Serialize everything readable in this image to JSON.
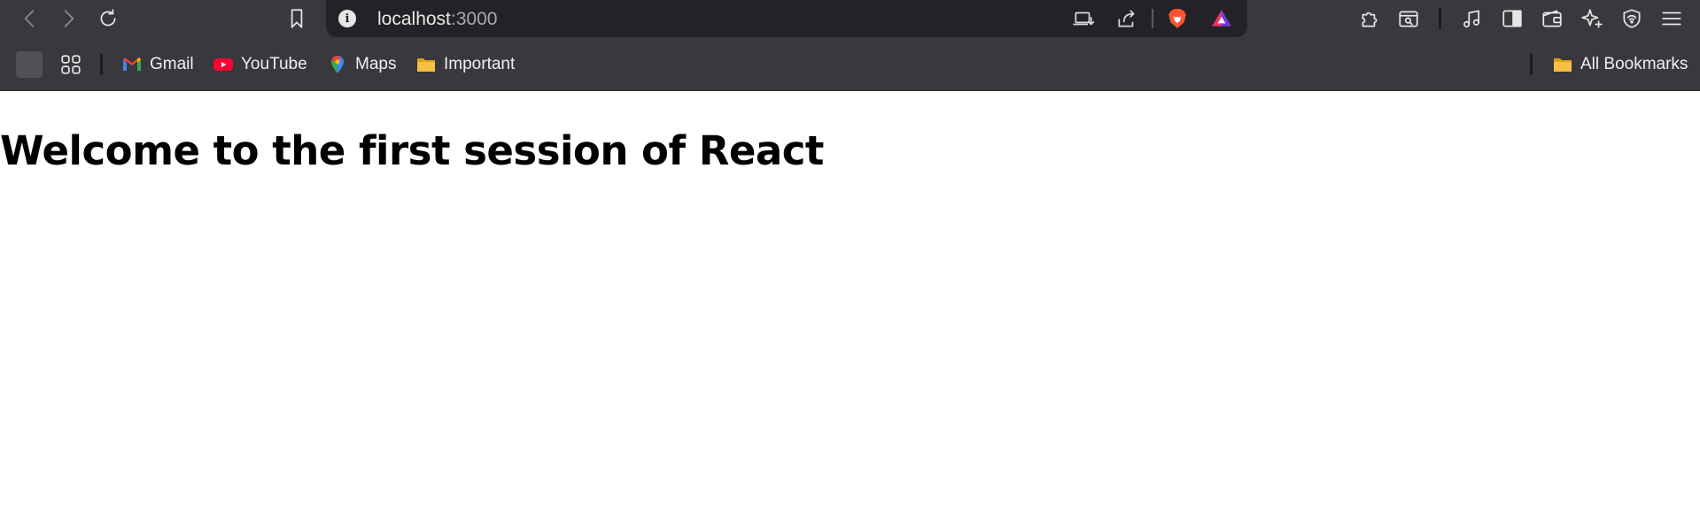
{
  "toolbar": {
    "back_label": "Back",
    "forward_label": "Forward",
    "reload_label": "Reload"
  },
  "address_bar": {
    "host": "localhost",
    "port": ":3000"
  },
  "bookmarks": {
    "items": [
      {
        "label": "Gmail",
        "icon": "gmail-icon"
      },
      {
        "label": "YouTube",
        "icon": "youtube-icon"
      },
      {
        "label": "Maps",
        "icon": "maps-icon"
      },
      {
        "label": "Important",
        "icon": "folder-icon"
      }
    ],
    "all_bookmarks_label": "All Bookmarks"
  },
  "page": {
    "heading": "Welcome to the first session of React"
  },
  "colors": {
    "toolbar_bg": "#38383d",
    "urlbar_bg": "#232327",
    "brave_orange": "#fb542b",
    "folder_yellow": "#f6c142",
    "youtube_red": "#ff0033"
  }
}
